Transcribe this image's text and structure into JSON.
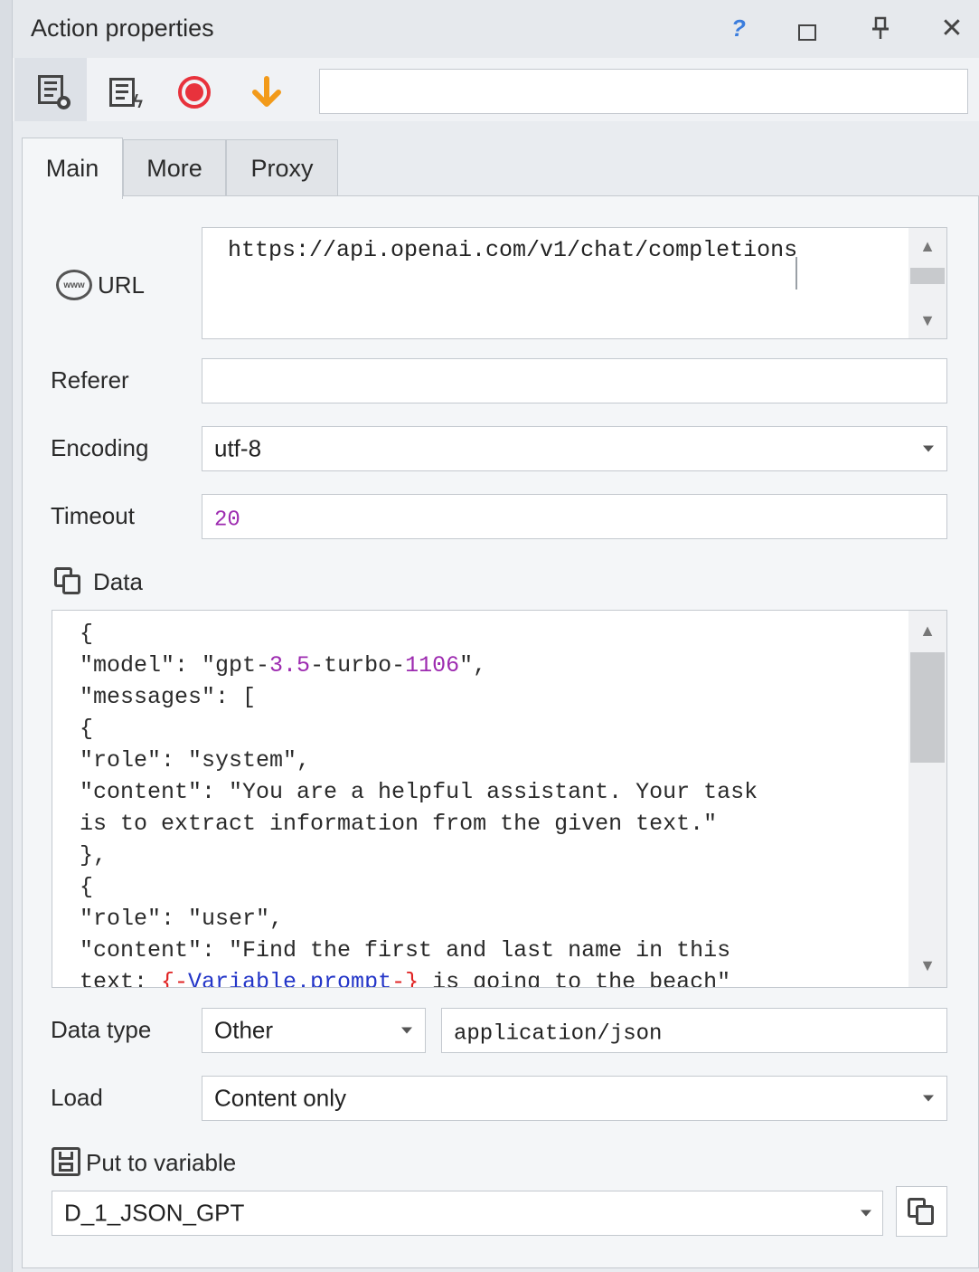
{
  "window": {
    "title": "Action properties",
    "help_glyph": "?",
    "close_glyph": "✕"
  },
  "toolbar": {
    "icons": [
      "doc-settings-icon",
      "doc-run-icon",
      "record-icon",
      "arrow-down-icon"
    ],
    "input_value": "",
    "colors": {
      "record": "#e8323c",
      "arrow": "#f29a1a"
    }
  },
  "tabs": [
    {
      "label": "Main",
      "active": true
    },
    {
      "label": "More",
      "active": false
    },
    {
      "label": "Proxy",
      "active": false
    }
  ],
  "form": {
    "url": {
      "label": "URL",
      "icon": "www-icon",
      "value": "https://api.openai.com/v1/chat/completions"
    },
    "referer": {
      "label": "Referer",
      "value": ""
    },
    "encoding": {
      "label": "Encoding",
      "value": "utf-8"
    },
    "timeout": {
      "label": "Timeout",
      "value": "20"
    },
    "data": {
      "label": "Data",
      "icon": "copy-icon",
      "lines": [
        "{",
        "\"model\": \"gpt-3.5-turbo-1106\",",
        "\"messages\": [",
        "{",
        "\"role\": \"system\",",
        "\"content\": \"You are a helpful assistant. Your task",
        "is to extract information from the given text.\"",
        "},",
        "{",
        "\"role\": \"user\",",
        "\"content\": \"Find the first and last name in this",
        "text: {-Variable.prompt-} is going to the beach\""
      ]
    },
    "data_type": {
      "label": "Data type",
      "value": "Other",
      "content_type": "application/json"
    },
    "load": {
      "label": "Load",
      "value": "Content only"
    },
    "put_to_variable": {
      "label": "Put to variable",
      "icon": "save-icon",
      "value": "D_1_JSON_GPT"
    }
  }
}
